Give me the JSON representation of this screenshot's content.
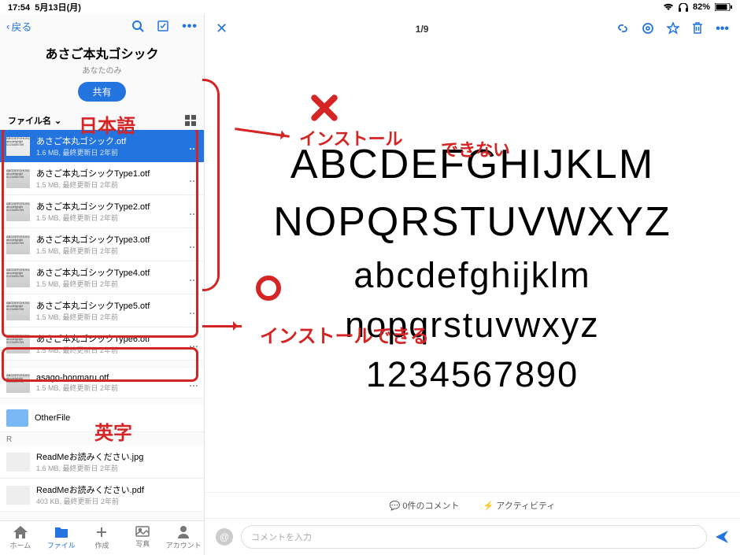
{
  "status": {
    "time": "17:54",
    "date": "5月13日(月)",
    "battery": "82%"
  },
  "sidebar": {
    "back": "戻る",
    "folder_title": "あさご本丸ゴシック",
    "folder_sub": "あなたのみ",
    "share": "共有",
    "sort_label": "ファイル名",
    "section_r": "R",
    "files": [
      {
        "name": "あさご本丸ゴシック.otf",
        "meta": "1.6 MB, 最終更新日 2年前",
        "selected": true
      },
      {
        "name": "あさご本丸ゴシックType1.otf",
        "meta": "1.5 MB, 最終更新日 2年前"
      },
      {
        "name": "あさご本丸ゴシックType2.otf",
        "meta": "1.5 MB, 最終更新日 2年前"
      },
      {
        "name": "あさご本丸ゴシックType3.otf",
        "meta": "1.5 MB, 最終更新日 2年前"
      },
      {
        "name": "あさご本丸ゴシックType4.otf",
        "meta": "1.5 MB, 最終更新日 2年前"
      },
      {
        "name": "あさご本丸ゴシックType5.otf",
        "meta": "1.5 MB, 最終更新日 2年前"
      },
      {
        "name": "あさご本丸ゴシックType6.otf",
        "meta": "1.5 MB, 最終更新日 2年前"
      },
      {
        "name": "asago-honmaru.otf",
        "meta": "1.5 MB, 最終更新日 2年前"
      },
      {
        "name": "OtherFile",
        "meta": "",
        "folder": true
      },
      {
        "name": "ReadMeお読みください.jpg",
        "meta": "1.6 MB, 最終更新日 2年前"
      },
      {
        "name": "ReadMeお読みください.pdf",
        "meta": "403 KB, 最終更新日 2年前"
      }
    ],
    "tabs": {
      "home": "ホーム",
      "file": "ファイル",
      "create": "作成",
      "photo": "写真",
      "account": "アカウント"
    }
  },
  "preview": {
    "page": "1/9",
    "alphabet": {
      "l1": "ABCDEFGHIJKLM",
      "l2": "NOPQRSTUVWXYZ",
      "l3": "abcdefghijklm",
      "l4": "nopqrstuvwxyz",
      "l5": "1234567890"
    },
    "comments": "0件のコメント",
    "activity": "アクティビティ",
    "comment_ph": "コメントを入力"
  },
  "annotations": {
    "japanese": "日本語",
    "cannot1": "インストール",
    "cannot2": "できない",
    "can": "インストールできる",
    "english": "英字"
  }
}
